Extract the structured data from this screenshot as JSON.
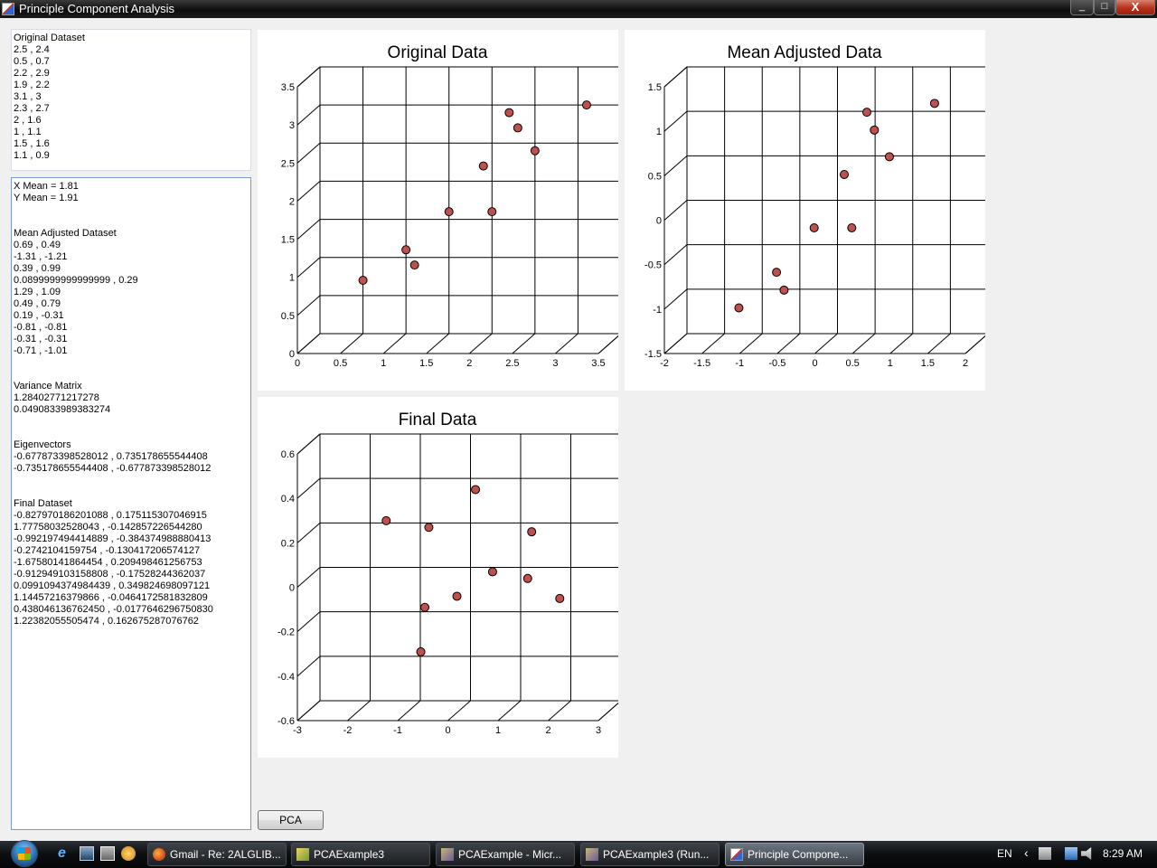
{
  "window": {
    "title": "Principle Component Analysis",
    "minimize": "_",
    "maximize": "□",
    "close": "X"
  },
  "left": {
    "original_text": "Original Dataset\n2.5 , 2.4\n0.5 , 0.7\n2.2 , 2.9\n1.9 , 2.2\n3.1 , 3\n2.3 , 2.7\n2 , 1.6\n1 , 1.1\n1.5 , 1.6\n1.1 , 0.9",
    "results_text": "X Mean = 1.81\nY Mean = 1.91\n\n\nMean Adjusted Dataset\n0.69 , 0.49\n-1.31 , -1.21\n0.39 , 0.99\n0.0899999999999999 , 0.29\n1.29 , 1.09\n0.49 , 0.79\n0.19 , -0.31\n-0.81 , -0.81\n-0.31 , -0.31\n-0.71 , -1.01\n\n\nVariance Matrix\n1.28402771217278\n0.0490833989383274\n\n\nEigenvectors\n-0.677873398528012 , 0.735178655544408\n-0.735178655544408 , -0.677873398528012\n\n\nFinal Dataset\n-0.827970186201088 , 0.175115307046915\n1.77758032528043 , -0.142857226544280\n-0.992197494414889 , -0.384374988880413\n-0.2742104159754 , -0.130417206574127\n-1.67580141864454 , 0.209498461256753\n-0.912949103158808 , -0.17528244362037\n0.0991094374984439 , 0.349824698097121\n1.14457216379866 , -0.0464172581832809\n0.438046136762450 , -0.0177646296750830\n1.22382055505474 , 0.162675287076762"
  },
  "button": {
    "pca": "PCA"
  },
  "chart_data": [
    {
      "type": "scatter",
      "title": "Original Data",
      "xlim": [
        0,
        3.5
      ],
      "ylim": [
        0,
        3.5
      ],
      "xticks": [
        "0",
        "0.5",
        "1",
        "1.5",
        "2",
        "2.5",
        "3",
        "3.5"
      ],
      "yticks": [
        "0",
        "0.5",
        "1",
        "1.5",
        "2",
        "2.5",
        "3",
        "3.5"
      ],
      "points": [
        [
          2.5,
          2.4
        ],
        [
          0.5,
          0.7
        ],
        [
          2.2,
          2.9
        ],
        [
          1.9,
          2.2
        ],
        [
          3.1,
          3.0
        ],
        [
          2.3,
          2.7
        ],
        [
          2.0,
          1.6
        ],
        [
          1.0,
          1.1
        ],
        [
          1.5,
          1.6
        ],
        [
          1.1,
          0.9
        ]
      ],
      "grid": true,
      "view": "3d"
    },
    {
      "type": "scatter",
      "title": "Mean Adjusted Data",
      "xlim": [
        -2,
        2
      ],
      "ylim": [
        -1.5,
        1.5
      ],
      "xticks": [
        "-2",
        "-1.5",
        "-1",
        "-0.5",
        "0",
        "0.5",
        "1",
        "1.5",
        "2"
      ],
      "yticks": [
        "-1.5",
        "-1",
        "-0.5",
        "0",
        "0.5",
        "1",
        "1.5"
      ],
      "points": [
        [
          0.69,
          0.49
        ],
        [
          -1.31,
          -1.21
        ],
        [
          0.39,
          0.99
        ],
        [
          0.09,
          0.29
        ],
        [
          1.29,
          1.09
        ],
        [
          0.49,
          0.79
        ],
        [
          0.19,
          -0.31
        ],
        [
          -0.81,
          -0.81
        ],
        [
          -0.31,
          -0.31
        ],
        [
          -0.71,
          -1.01
        ]
      ],
      "grid": true,
      "view": "3d"
    },
    {
      "type": "scatter",
      "title": "Final Data",
      "xlim": [
        -3,
        3
      ],
      "ylim": [
        -0.6,
        0.6
      ],
      "xticks": [
        "-3",
        "-2",
        "-1",
        "0",
        "1",
        "2",
        "3"
      ],
      "yticks": [
        "-0.6",
        "-0.4",
        "-0.2",
        "0",
        "0.2",
        "0.4",
        "0.6"
      ],
      "points": [
        [
          -0.83,
          0.18
        ],
        [
          1.78,
          -0.14
        ],
        [
          -0.99,
          -0.38
        ],
        [
          -0.27,
          -0.13
        ],
        [
          -1.68,
          0.21
        ],
        [
          -0.91,
          -0.18
        ],
        [
          0.1,
          0.35
        ],
        [
          1.14,
          -0.05
        ],
        [
          0.44,
          -0.02
        ],
        [
          1.22,
          0.16
        ]
      ],
      "grid": true,
      "view": "3d"
    }
  ],
  "taskbar": {
    "tasks": [
      "Gmail - Re: 2ALGLIB...",
      "PCAExample3",
      "PCAExample - Micr...",
      "PCAExample3 (Run...",
      "Principle Compone..."
    ],
    "lang": "EN",
    "clock": "8:29 AM"
  },
  "colors": {
    "marker": "#c0504d",
    "grid": "#000000",
    "title_bar": "#1a1a1a"
  }
}
